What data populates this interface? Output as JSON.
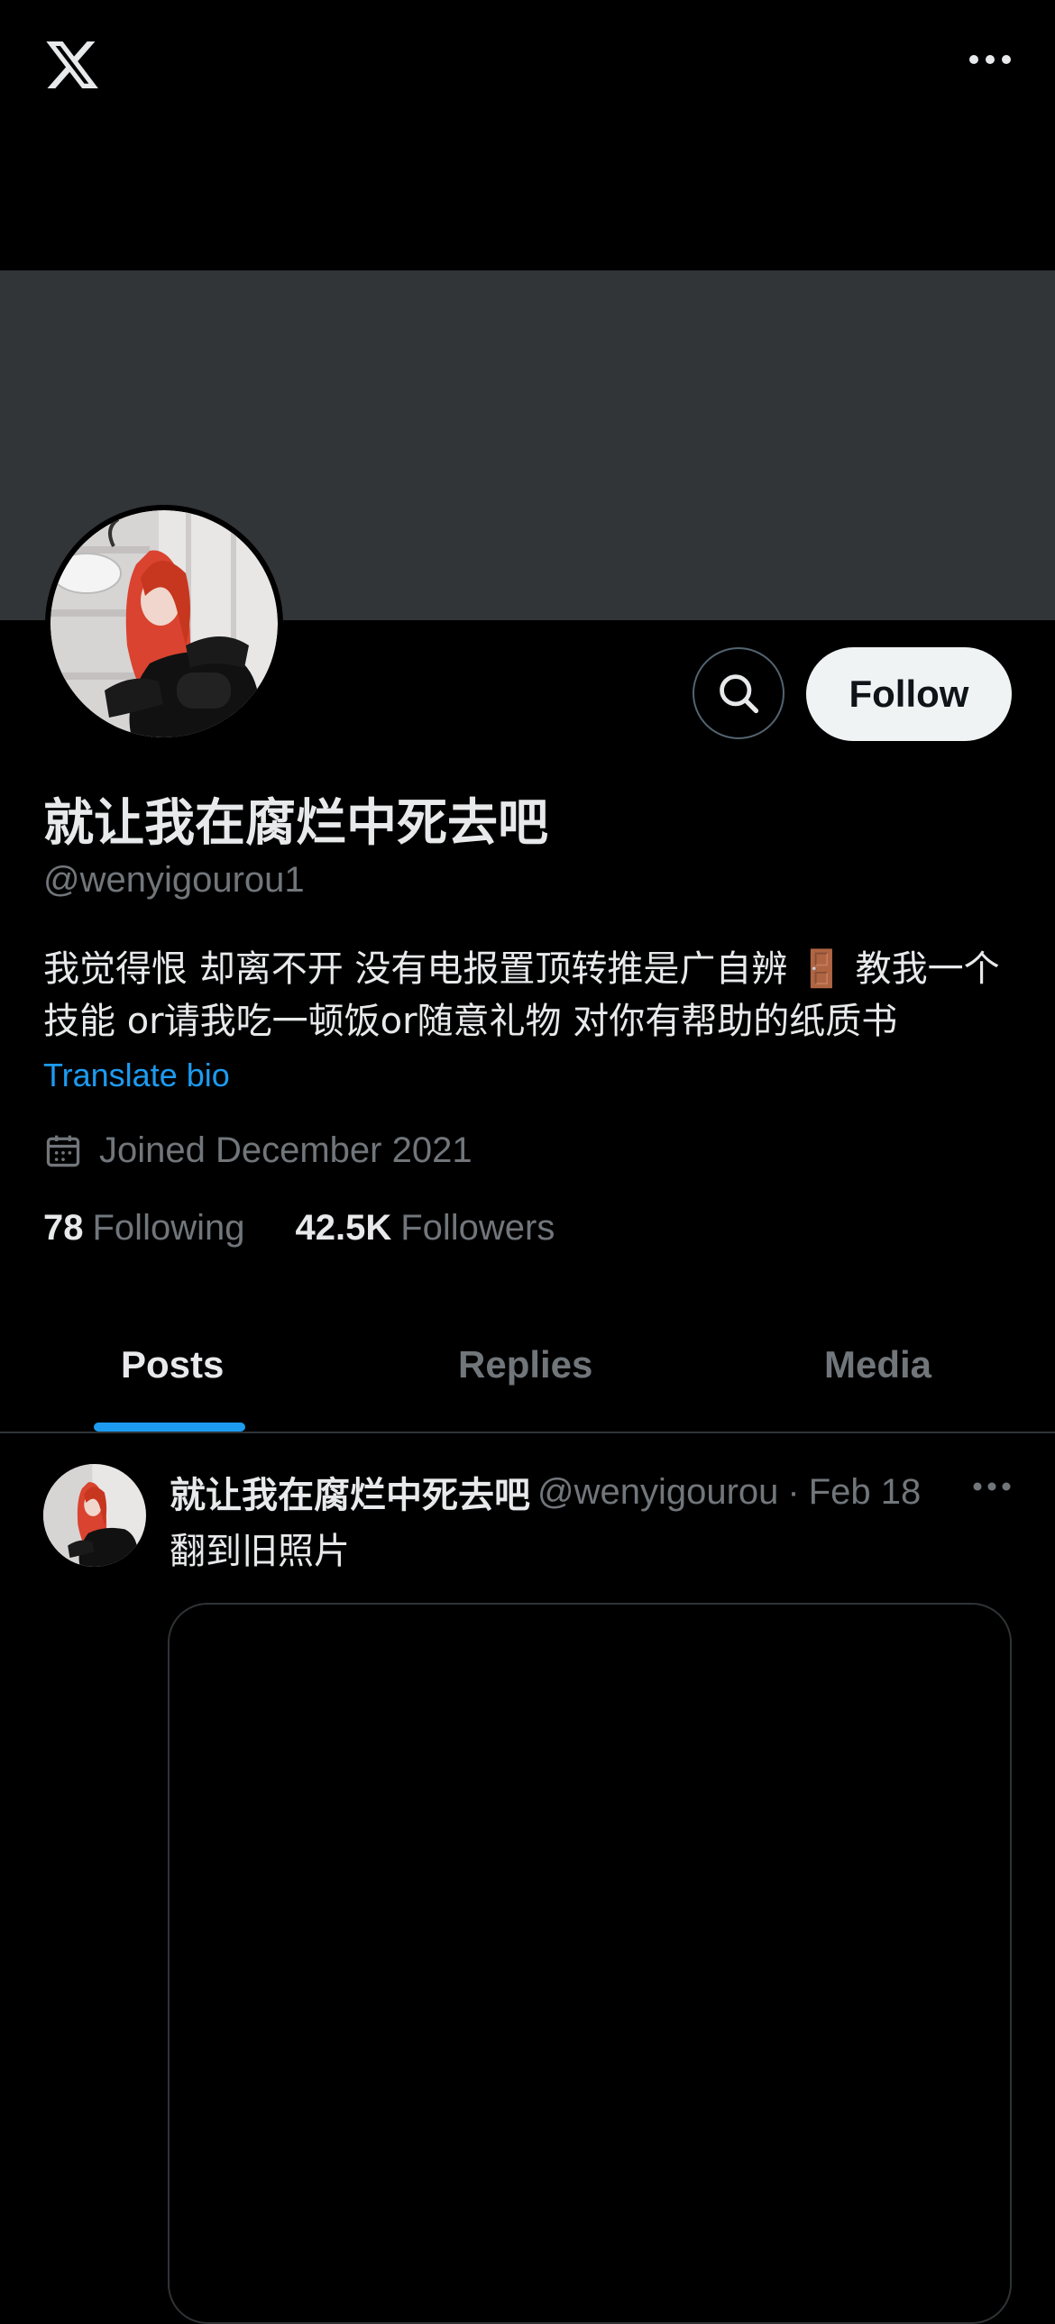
{
  "profile": {
    "display_name": "就让我在腐烂中死去吧",
    "handle": "@wenyigourou1",
    "bio": "我觉得恨 却离不开 没有电报置顶转推是广自辨 🚪 教我一个技能 or请我吃一顿饭or随意礼物 对你有帮助的纸质书",
    "translate_label": "Translate bio",
    "joined": "Joined December 2021",
    "following_count": "78",
    "following_label": "Following",
    "followers_count": "42.5K",
    "followers_label": "Followers"
  },
  "actions": {
    "follow_label": "Follow"
  },
  "tabs": [
    {
      "label": "Posts",
      "active": true
    },
    {
      "label": "Replies",
      "active": false
    },
    {
      "label": "Media",
      "active": false
    }
  ],
  "post": {
    "author_name": "就让我在腐烂中死去吧",
    "author_handle": "@wenyigourou",
    "separator": "·",
    "date": "Feb 18",
    "text": "翻到旧照片"
  },
  "icons": {
    "logo": "x-logo-icon",
    "more": "more-horizontal-icon",
    "search": "search-icon",
    "calendar": "calendar-icon"
  },
  "colors": {
    "accent": "#1d9bf0",
    "banner": "#323538",
    "secondary_text": "#71767b"
  }
}
